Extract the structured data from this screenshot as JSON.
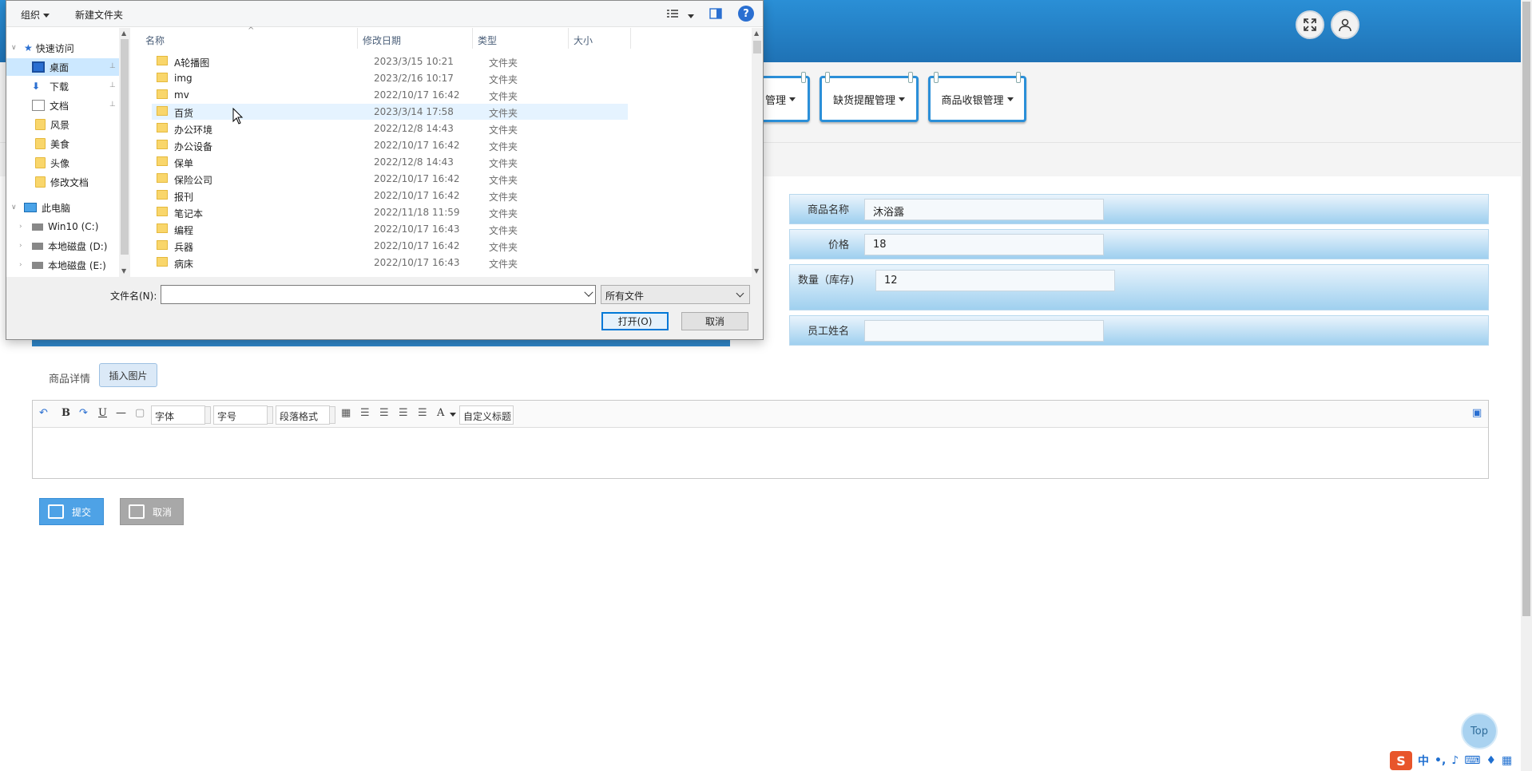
{
  "header": {
    "fullscreen_icon": "expand-icon",
    "user_icon": "user-icon"
  },
  "nav": {
    "items": [
      {
        "label": "管理"
      },
      {
        "label": "缺货提醒管理"
      },
      {
        "label": "商品收银管理"
      }
    ]
  },
  "form": {
    "name_label": "商品名称",
    "name_value": "沐浴露",
    "price_label": "价格",
    "price_value": "18",
    "qty_label": "数量（库存)",
    "qty_value": "12",
    "staff_label": "员工姓名",
    "staff_value": ""
  },
  "detail": {
    "label": "商品详情",
    "insert_image": "插入图片"
  },
  "editor": {
    "font_label": "字体",
    "size_label": "字号",
    "para_label": "段落格式",
    "custom_label": "自定义标题",
    "bold": "B",
    "italic": "I",
    "underline": "U",
    "fontcolor": "A"
  },
  "actions": {
    "submit": "提交",
    "cancel": "取消"
  },
  "top_button": "Top",
  "ime": {
    "logo": "S",
    "lang": "中"
  },
  "dialog": {
    "toolbar": {
      "organize": "组织",
      "new_folder": "新建文件夹"
    },
    "nav_pane": [
      {
        "label": "快速访问",
        "icon": "star-icon"
      },
      {
        "label": "桌面",
        "icon": "desktop-icon",
        "pinned": true
      },
      {
        "label": "下载",
        "icon": "download-icon",
        "pinned": true
      },
      {
        "label": "文档",
        "icon": "document-icon",
        "pinned": true
      },
      {
        "label": "风景",
        "icon": "folder-icon"
      },
      {
        "label": "美食",
        "icon": "folder-icon"
      },
      {
        "label": "头像",
        "icon": "folder-icon"
      },
      {
        "label": "修改文档",
        "icon": "folder-icon"
      },
      {
        "label": "此电脑",
        "icon": "computer-icon"
      },
      {
        "label": "Win10 (C:)",
        "icon": "drive-icon"
      },
      {
        "label": "本地磁盘 (D:)",
        "icon": "drive-icon"
      },
      {
        "label": "本地磁盘 (E:)",
        "icon": "drive-icon"
      }
    ],
    "columns": {
      "name": "名称",
      "date": "修改日期",
      "type": "类型",
      "size": "大小"
    },
    "files": [
      {
        "name": "A轮播图",
        "date": "2023/3/15 10:21",
        "type": "文件夹"
      },
      {
        "name": "img",
        "date": "2023/2/16 10:17",
        "type": "文件夹"
      },
      {
        "name": "mv",
        "date": "2022/10/17 16:42",
        "type": "文件夹"
      },
      {
        "name": "百货",
        "date": "2023/3/14 17:58",
        "type": "文件夹"
      },
      {
        "name": "办公环境",
        "date": "2022/12/8 14:43",
        "type": "文件夹"
      },
      {
        "name": "办公设备",
        "date": "2022/10/17 16:42",
        "type": "文件夹"
      },
      {
        "name": "保单",
        "date": "2022/12/8 14:43",
        "type": "文件夹"
      },
      {
        "name": "保险公司",
        "date": "2022/10/17 16:42",
        "type": "文件夹"
      },
      {
        "name": "报刊",
        "date": "2022/10/17 16:42",
        "type": "文件夹"
      },
      {
        "name": "笔记本",
        "date": "2022/11/18 11:59",
        "type": "文件夹"
      },
      {
        "name": "编程",
        "date": "2022/10/17 16:43",
        "type": "文件夹"
      },
      {
        "name": "兵器",
        "date": "2022/10/17 16:42",
        "type": "文件夹"
      },
      {
        "name": "病床",
        "date": "2022/10/17 16:43",
        "type": "文件夹"
      }
    ],
    "filename_label": "文件名(N):",
    "filename_value": "",
    "filetype_value": "所有文件",
    "open_button": "打开(O)",
    "cancel_button": "取消"
  }
}
